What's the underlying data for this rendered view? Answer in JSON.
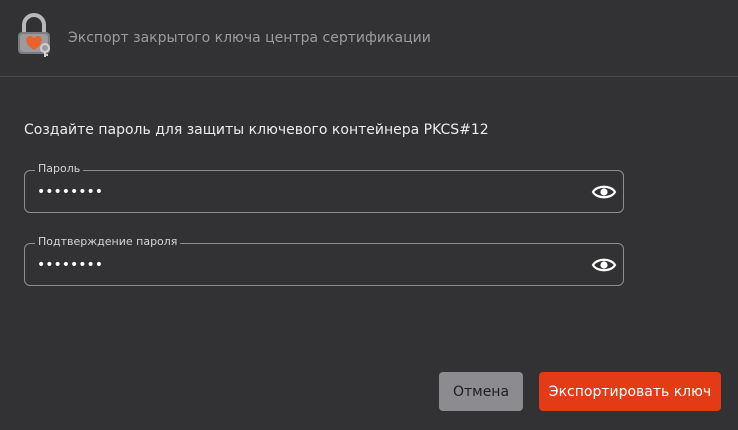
{
  "window": {
    "title": "Экспорт закрытого ключа центра сертификации",
    "icon": "lock-with-key-icon"
  },
  "form": {
    "prompt": "Создайте пароль для защиты ключевого контейнера PKCS#12",
    "password": {
      "label": "Пароль",
      "value": "••••••••",
      "toggle_icon": "eye-icon"
    },
    "confirm": {
      "label": "Подтверждение пароля",
      "value": "••••••••",
      "toggle_icon": "eye-icon"
    }
  },
  "buttons": {
    "cancel_label": "Отмена",
    "export_label": "Экспортировать ключ"
  },
  "colors": {
    "background": "#323234",
    "accent": "#e33b16",
    "cancel": "#8c8c90"
  }
}
